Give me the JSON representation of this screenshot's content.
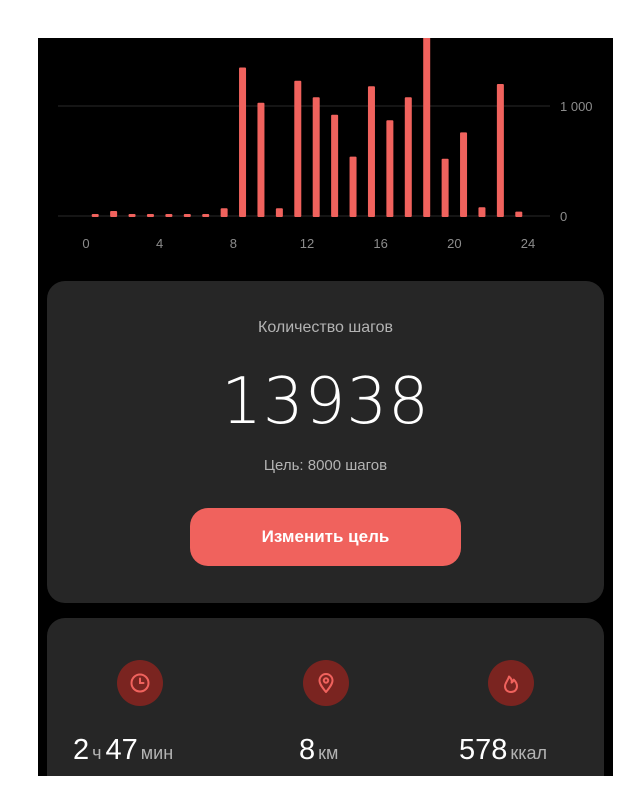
{
  "colors": {
    "bar": "#f0625d",
    "background": "#000000",
    "card": "#262626",
    "grid": "#2a2a2a",
    "axis_text": "#8c8c8c",
    "icon_circle": "#7a2420",
    "icon_stroke": "#f0625d"
  },
  "chart_data": {
    "type": "bar",
    "x": [
      0,
      1,
      2,
      3,
      4,
      5,
      6,
      7,
      8,
      9,
      10,
      11,
      12,
      13,
      14,
      15,
      16,
      17,
      18,
      19,
      20,
      21,
      22,
      23
    ],
    "values": [
      5,
      45,
      15,
      0,
      0,
      0,
      10,
      70,
      1350,
      1030,
      70,
      1230,
      1080,
      920,
      540,
      1180,
      870,
      1080,
      1700,
      520,
      760,
      80,
      1200,
      40
    ],
    "xticks": [
      "0",
      "4",
      "8",
      "12",
      "16",
      "20",
      "24"
    ],
    "yticks": [
      "1 000",
      "0"
    ],
    "ylim": [
      0,
      1500
    ],
    "grid": true
  },
  "steps": {
    "title": "Количество шагов",
    "value": "13938",
    "goal": "Цель: 8000 шагов",
    "change_goal_label": "Изменить цель"
  },
  "stats": {
    "time": {
      "hours": "2",
      "hours_unit": "ч",
      "minutes": "47",
      "minutes_unit": "мин",
      "icon": "clock-icon"
    },
    "distance": {
      "value": "8",
      "unit": "км",
      "icon": "location-pin-icon"
    },
    "calories": {
      "value": "578",
      "unit": "ккал",
      "icon": "flame-icon"
    }
  }
}
